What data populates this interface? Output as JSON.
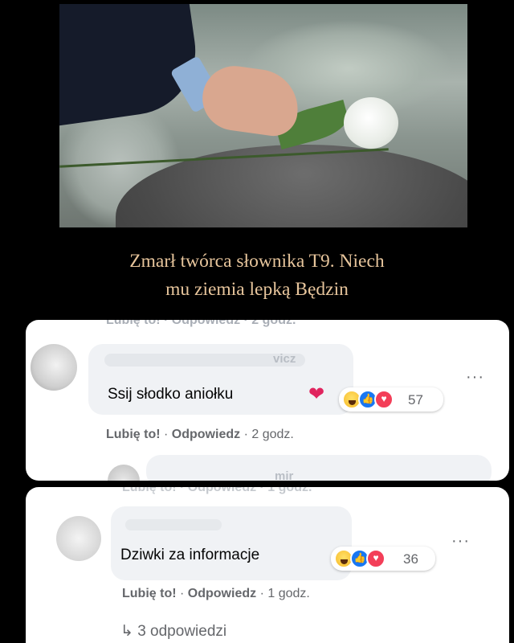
{
  "meme": {
    "caption_line1": "Zmarł twórca słownika T9. Niech",
    "caption_line2": "mu ziemia lepką Będzin"
  },
  "comment1": {
    "prev_meta_ghost": "Lubię to! · Odpowiedz · 2 godz.",
    "author_ghost": "vicz",
    "text": "Ssij słodko aniołku",
    "emoji": "❤",
    "reaction_count": "57",
    "like_label": "Lubię to!",
    "separator": "·",
    "reply_label": "Odpowiedz",
    "time": "2 godz.",
    "next_author_ghost": "mir",
    "more": "···",
    "colors": {
      "heart": "#e0245e"
    }
  },
  "comment2": {
    "prev_meta_ghost": "Lubię to! · Odpowiedz · 1 godz.",
    "text": "Dziwki za informacje",
    "reaction_count": "36",
    "like_label": "Lubię to!",
    "separator": "·",
    "reply_label": "Odpowiedz",
    "time": "1 godz.",
    "replies_icon": "↳",
    "replies": "3 odpowiedzi",
    "more": "···"
  },
  "icons": {
    "reactions": [
      "haha-icon",
      "like-icon",
      "love-icon"
    ],
    "more": "more-options-icon",
    "reply_arrow": "reply-arrow-icon"
  }
}
